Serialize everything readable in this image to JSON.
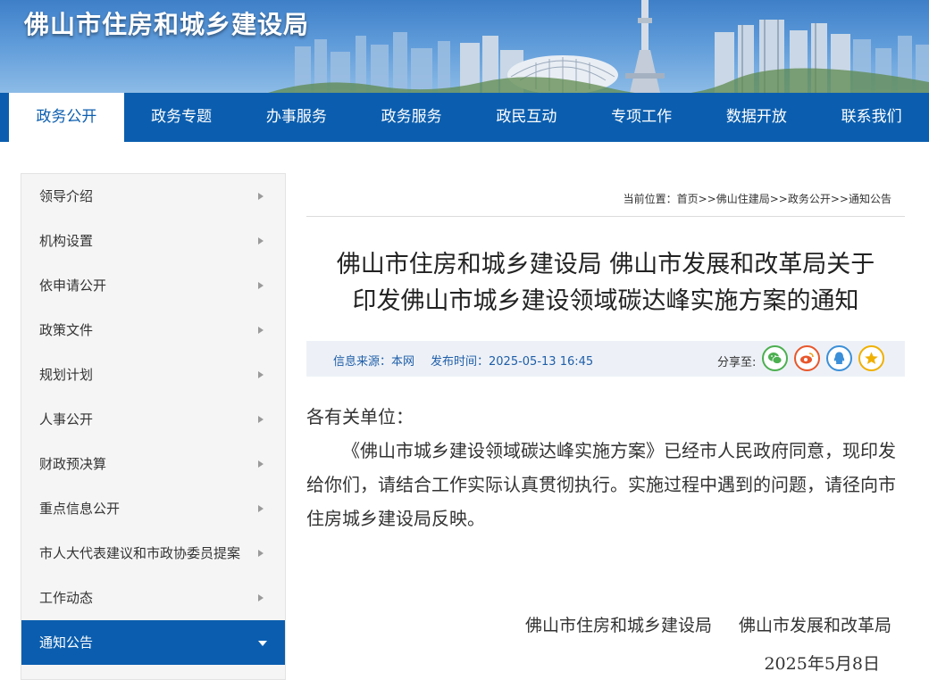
{
  "site": {
    "title": "佛山市住房和城乡建设局"
  },
  "nav": [
    {
      "label": "政务公开",
      "active": true
    },
    {
      "label": "政务专题"
    },
    {
      "label": "办事服务"
    },
    {
      "label": "政务服务"
    },
    {
      "label": "政民互动"
    },
    {
      "label": "专项工作"
    },
    {
      "label": "数据开放"
    },
    {
      "label": "联系我们"
    }
  ],
  "sidebar": [
    {
      "label": "领导介绍"
    },
    {
      "label": "机构设置"
    },
    {
      "label": "依申请公开"
    },
    {
      "label": "政策文件"
    },
    {
      "label": "规划计划"
    },
    {
      "label": "人事公开"
    },
    {
      "label": "财政预决算"
    },
    {
      "label": "重点信息公开"
    },
    {
      "label": "市人大代表建议和市政协委员提案"
    },
    {
      "label": "工作动态"
    },
    {
      "label": "通知公告",
      "active": true
    }
  ],
  "breadcrumb": {
    "prefix": "当前位置：",
    "items": [
      "首页",
      "佛山住建局",
      "政务公开",
      "通知公告"
    ],
    "separator": ">>"
  },
  "article": {
    "title_line1": "佛山市住房和城乡建设局 佛山市发展和改革局关于",
    "title_line2": "印发佛山市城乡建设领域碳达峰实施方案的通知",
    "source_label": "信息来源：本网",
    "publish_label": "发布时间：2025-05-13 16:45",
    "share_label": "分享至:",
    "salutation": "各有关单位：",
    "paragraph": "《佛山市城乡建设领域碳达峰实施方案》已经市人民政府同意，现印发给你们，请结合工作实际认真贯彻执行。实施过程中遇到的问题，请径向市住房城乡建设局反映。",
    "signer1": "佛山市住房和城乡建设局",
    "signer2": "佛山市发展和改革局",
    "date": "2025年5月8日"
  },
  "share_icons": [
    {
      "name": "wechat-icon",
      "color": "#4caf50"
    },
    {
      "name": "weibo-icon",
      "color": "#e8572c"
    },
    {
      "name": "qq-icon",
      "color": "#3b8fd8"
    },
    {
      "name": "qzone-icon",
      "color": "#f0b000"
    }
  ],
  "colors": {
    "nav_bg": "#0b5eaf",
    "meta_bg": "#edf1f7",
    "meta_text": "#1f5ea8"
  }
}
